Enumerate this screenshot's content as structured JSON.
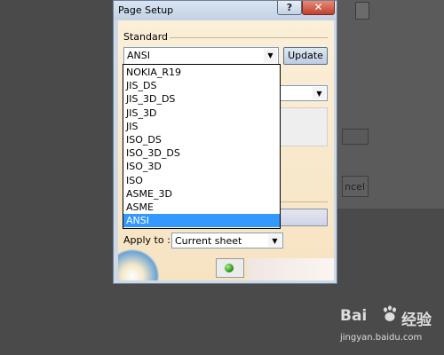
{
  "dialog": {
    "title": "Page Setup",
    "help_glyph": "?",
    "close_glyph": "✕",
    "standard_group_label": "Standard",
    "standard_value": "ANSI",
    "update_label": "Update",
    "hidden_button_partial": "ncel",
    "apply_label": "Apply to :",
    "apply_value": "Current sheet"
  },
  "dropdown": {
    "items": [
      "NOKIA_R19",
      "JIS_DS",
      "JIS_3D_DS",
      "JIS_3D",
      "JIS",
      "ISO_DS",
      "ISO_3D_DS",
      "ISO_3D",
      "ISO",
      "ASME_3D",
      "ASME",
      "ANSI"
    ],
    "selected": "ANSI"
  },
  "icons": {
    "combo_arrow": "▼",
    "ok_button_icon": "green-dot-icon"
  },
  "watermark": {
    "brand_left": "Bai",
    "brand_right": "经验",
    "url": "jingyan.baidu.com"
  },
  "colors": {
    "desktop": "#4a4a4a",
    "selection": "#3399ff",
    "client_background": "#fbefd8"
  }
}
